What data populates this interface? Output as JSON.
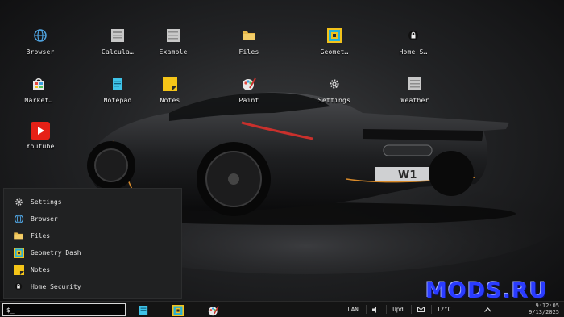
{
  "desktop": {
    "icons": [
      {
        "label": "Browser",
        "icon": "globe-icon"
      },
      {
        "label": "Calcula…",
        "icon": "calculator-icon"
      },
      {
        "label": "Example",
        "icon": "window-icon"
      },
      {
        "label": "Files",
        "icon": "folder-icon"
      },
      {
        "label": "Geomet…",
        "icon": "geometry-dash-icon"
      },
      {
        "label": "Home S…",
        "icon": "home-security-icon"
      },
      {
        "label": "Market…",
        "icon": "market-icon"
      },
      {
        "label": "Notepad",
        "icon": "notepad-icon"
      },
      {
        "label": "Notes",
        "icon": "notes-icon"
      },
      {
        "label": "Paint",
        "icon": "paint-icon"
      },
      {
        "label": "Settings",
        "icon": "gear-icon"
      },
      {
        "label": "Weather",
        "icon": "weather-icon"
      },
      {
        "label": "Youtube",
        "icon": "youtube-icon"
      }
    ]
  },
  "start_menu": {
    "items": [
      {
        "label": "Settings",
        "icon": "gear-icon"
      },
      {
        "label": "Browser",
        "icon": "globe-icon"
      },
      {
        "label": "Files",
        "icon": "folder-icon"
      },
      {
        "label": "Geometry Dash",
        "icon": "geometry-dash-icon"
      },
      {
        "label": "Notes",
        "icon": "notes-icon"
      },
      {
        "label": "Home Security",
        "icon": "home-security-icon"
      }
    ]
  },
  "taskbar": {
    "run_value": "$_",
    "apps": [
      {
        "name": "notepad",
        "icon": "notepad-icon"
      },
      {
        "name": "geometry-dash",
        "icon": "geometry-dash-icon"
      },
      {
        "name": "paint",
        "icon": "paint-icon"
      }
    ],
    "tray": {
      "lan": "LAN",
      "volume_icon": "speaker-icon",
      "update": "Upd",
      "mail_icon": "mail-icon",
      "weather": "12°C",
      "chevron_icon": "chevron-up-icon",
      "time": "9:12:05",
      "date": "9/13/2025"
    }
  },
  "watermark": "MODS.RU",
  "colors": {
    "taskbar_bg": "#141414",
    "menu_bg": "#202122",
    "watermark": "#2a3cff"
  }
}
